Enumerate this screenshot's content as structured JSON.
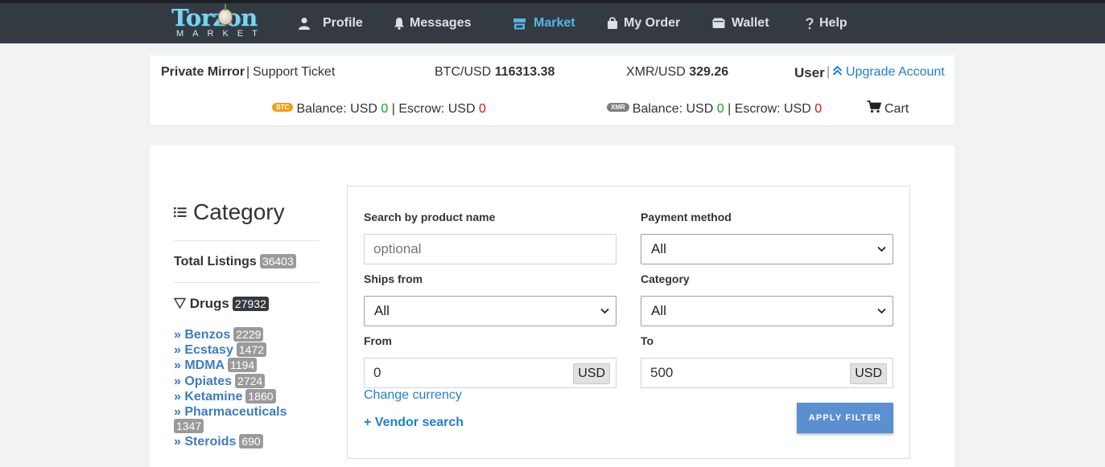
{
  "brand": {
    "logo_word": "Torzon",
    "logo_sub": "MARKET"
  },
  "nav": {
    "profile": "Profile",
    "messages": "Messages",
    "market": "Market",
    "my_order": "My Order",
    "wallet": "Wallet",
    "help": "Help"
  },
  "topbar": {
    "private_mirror": "Private Mirror",
    "separator": "|",
    "support_ticket": "Support Ticket",
    "btc_label": "BTC/USD",
    "btc_rate": "116313.38",
    "xmr_label": "XMR/USD",
    "xmr_rate": "329.26",
    "user": "User",
    "upgrade": "Upgrade Account",
    "btc_coin": "BTC",
    "xmr_coin": "XMR",
    "balance_label": "Balance: USD",
    "escrow_label": "| Escrow: USD",
    "btc_balance": "0",
    "btc_escrow": "0",
    "xmr_balance": "0",
    "xmr_escrow": "0",
    "cart": "Cart"
  },
  "sidebar": {
    "title": "Category",
    "total_label": "Total Listings",
    "total_count": "36403",
    "drugs_label": "Drugs",
    "drugs_count": "27932",
    "items": [
      {
        "label": "» Benzos",
        "count": "2229"
      },
      {
        "label": "» Ecstasy",
        "count": "1472"
      },
      {
        "label": "» MDMA",
        "count": "1194"
      },
      {
        "label": "» Opiates",
        "count": "2724"
      },
      {
        "label": "» Ketamine",
        "count": "1860"
      },
      {
        "label": "» Pharmaceuticals",
        "count": "1347"
      },
      {
        "label": "» Steroids",
        "count": "690"
      }
    ]
  },
  "filter": {
    "search_label": "Search by product name",
    "search_placeholder": "optional",
    "payment_label": "Payment method",
    "payment_value": "All",
    "ships_label": "Ships from",
    "ships_value": "All",
    "category_label": "Category",
    "category_value": "All",
    "from_label": "From",
    "from_value": "0",
    "to_label": "To",
    "to_value": "500",
    "unit": "USD",
    "change_currency": "Change currency",
    "vendor_search": "+ Vendor search",
    "apply": "APPLY FILTER"
  }
}
